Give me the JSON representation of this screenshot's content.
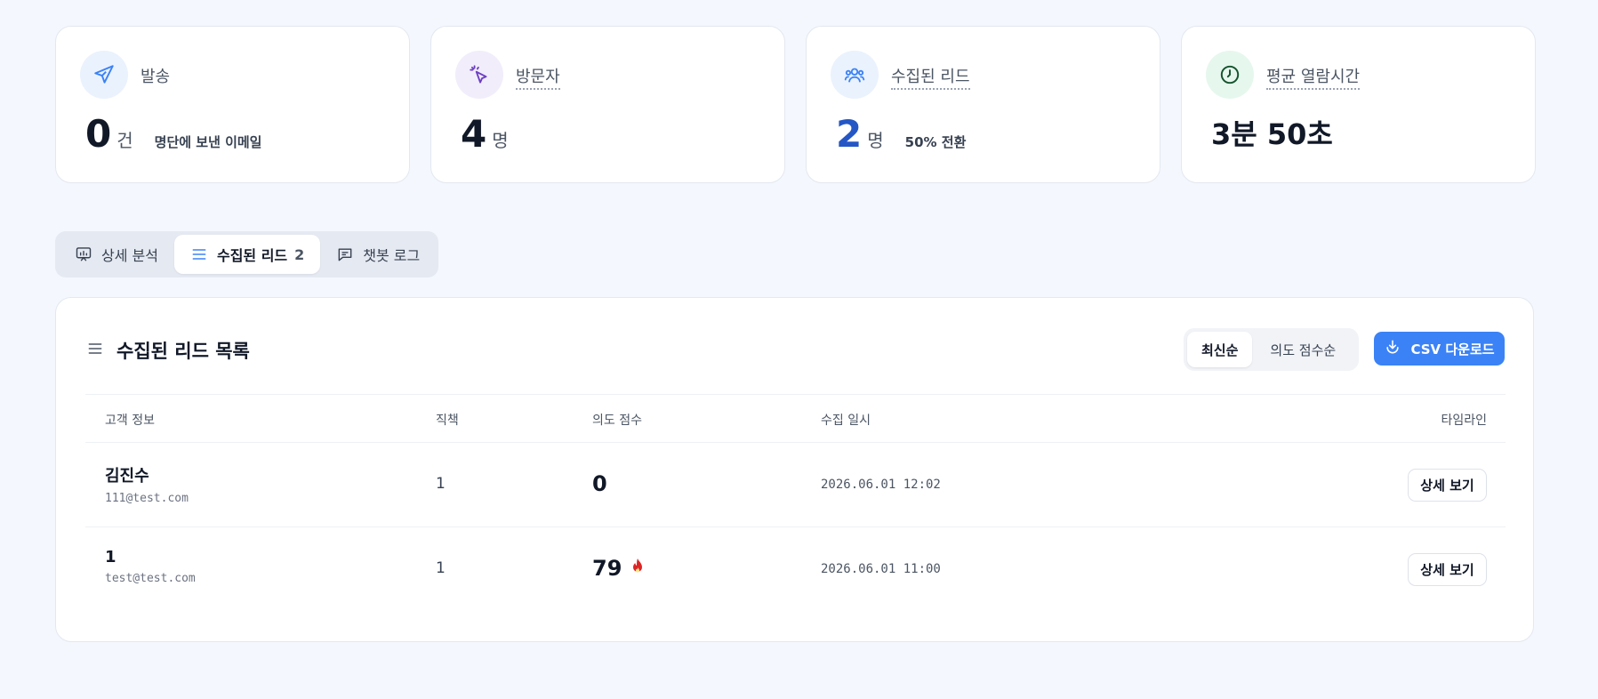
{
  "stats": [
    {
      "label": "발송",
      "value": "0",
      "unit": "건",
      "sub": "명단에 보낸 이메일",
      "icon": "send-icon"
    },
    {
      "label": "방문자",
      "value": "4",
      "unit": "명",
      "icon": "click-icon"
    },
    {
      "label": "수집된 리드",
      "value": "2",
      "unit": "명",
      "sub": "50% 전환",
      "icon": "users-icon"
    },
    {
      "label": "평균 열람시간",
      "value": "3분 50초",
      "icon": "clock-icon"
    }
  ],
  "tabs": [
    {
      "label": "상세 분석",
      "icon": "chart-icon"
    },
    {
      "label": "수집된 리드",
      "count": "2",
      "icon": "list-icon"
    },
    {
      "label": "챗봇 로그",
      "icon": "chat-icon"
    }
  ],
  "panel": {
    "title": "수집된 리드 목록",
    "sort": [
      "최신순",
      "의도 점수순"
    ],
    "csv_label": "CSV 다운로드",
    "columns": [
      "고객 정보",
      "직책",
      "의도 점수",
      "수집 일시",
      "타임라인"
    ],
    "rows": [
      {
        "name": "김진수",
        "email": "111@test.com",
        "role": "1",
        "score": "0",
        "date": "2026.06.01 12:02",
        "action": "상세 보기",
        "hot": false
      },
      {
        "name": "1",
        "email": "test@test.com",
        "role": "1",
        "score": "79",
        "date": "2026.06.01 11:00",
        "action": "상세 보기",
        "hot": true
      }
    ]
  },
  "colors": {
    "accent": "#3b82f6",
    "lead_blue": "#2457c5",
    "hot": "#dc2626"
  }
}
